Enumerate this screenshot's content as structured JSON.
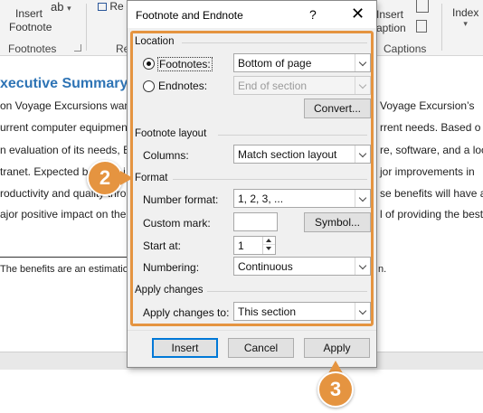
{
  "ribbon": {
    "insert_footnote_line1": "Insert",
    "insert_footnote_line2": "Footnote",
    "ab_label": "ab",
    "re_label": "Re",
    "re_fragment": "Re",
    "footnotes_group": "Footnotes",
    "insert_caption_line1": "Insert",
    "insert_caption_line2": "aption",
    "captions_group": "Captions",
    "index_label": "Index"
  },
  "document": {
    "heading": "xecutive Summary",
    "lines": [
      "on Voyage Excursions want",
      "urrent computer equipmen",
      "n evaluation of its needs, B",
      "tranet. Expected benefits i",
      "roductivity and quality thro",
      "ajor positive impact on the"
    ],
    "right_lines": [
      "Voyage Excursion’s",
      "rrent needs. Based o",
      "re, software, and a loca",
      "jor improvements in",
      "se benefits will have a",
      "l of providing the best"
    ],
    "footnote_text": "The benefits are an estimation",
    "footnote_end": "n."
  },
  "dialog": {
    "title": "Footnote and Endnote",
    "help": "?",
    "close": "✕",
    "location_section": "Location",
    "footnotes_label": "Footnotes:",
    "footnotes_value": "Bottom of page",
    "endnotes_label": "Endnotes:",
    "endnotes_value": "End of section",
    "convert_button": "Convert...",
    "layout_section": "Footnote layout",
    "columns_label": "Columns:",
    "columns_value": "Match section layout",
    "format_section": "Format",
    "number_format_label": "Number format:",
    "number_format_value": "1, 2, 3, ...",
    "custom_mark_label": "Custom mark:",
    "custom_mark_value": "",
    "symbol_button": "Symbol...",
    "start_at_label": "Start at:",
    "start_at_value": "1",
    "numbering_label": "Numbering:",
    "numbering_value": "Continuous",
    "apply_section": "Apply changes",
    "apply_changes_to_label": "Apply changes to:",
    "apply_changes_to_value": "This section",
    "insert_button": "Insert",
    "cancel_button": "Cancel",
    "apply_button": "Apply"
  },
  "callouts": {
    "step2": "2",
    "step3": "3"
  },
  "colors": {
    "accent_orange": "#e59440",
    "heading_blue": "#2e74b5",
    "default_button_border": "#0078d7"
  }
}
